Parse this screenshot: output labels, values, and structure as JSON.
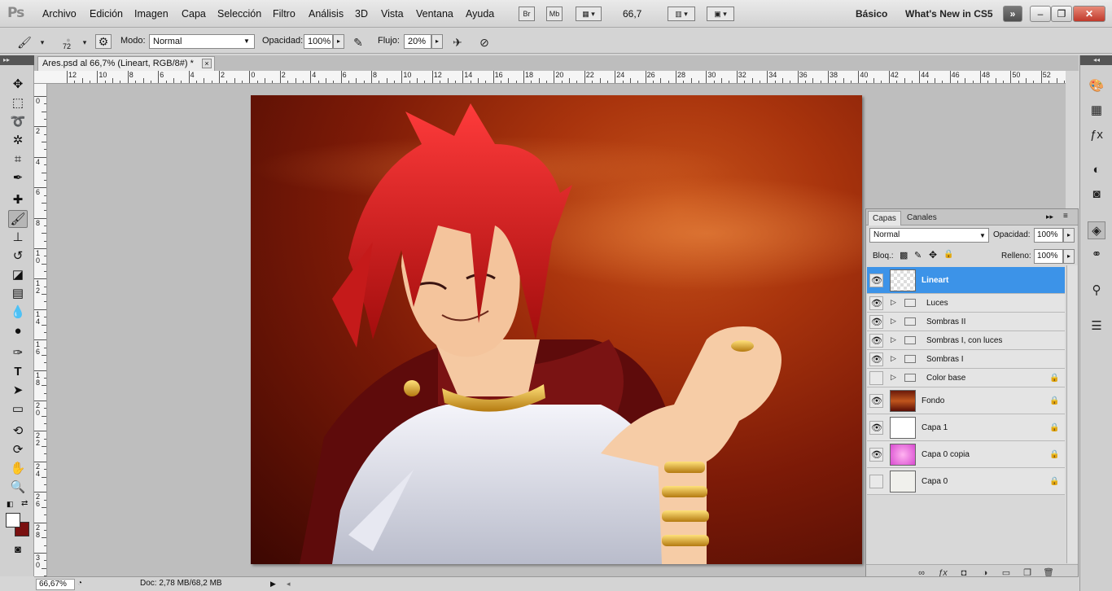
{
  "app": {
    "logo": "Ps",
    "menu": [
      "Archivo",
      "Edición",
      "Imagen",
      "Capa",
      "Selección",
      "Filtro",
      "Análisis",
      "3D",
      "Vista",
      "Ventana",
      "Ayuda"
    ],
    "bridge_label": "Br",
    "minibridge_label": "Mb",
    "zoom_value": "66,7",
    "workspace": "Básico",
    "whats_new": "What's New in CS5"
  },
  "options": {
    "brush_size": "72",
    "mode_label": "Modo:",
    "mode_value": "Normal",
    "opacity_label": "Opacidad:",
    "opacity_value": "100%",
    "flow_label": "Flujo:",
    "flow_value": "20%"
  },
  "document": {
    "tab_title": "Ares.psd al 66,7% (Lineart, RGB/8#) *",
    "close": "×"
  },
  "rulers": {
    "h_labels": [
      "12",
      "10",
      "8",
      "6",
      "4",
      "2",
      "0",
      "2",
      "4",
      "6",
      "8",
      "10",
      "12",
      "14",
      "16",
      "18",
      "20",
      "22",
      "24",
      "26",
      "28",
      "30",
      "32",
      "34",
      "36",
      "38",
      "40",
      "42",
      "44",
      "46",
      "48",
      "50",
      "52"
    ],
    "v_labels": [
      "0",
      "2",
      "4",
      "6",
      "8",
      "1\n0",
      "1\n2",
      "1\n4",
      "1\n6",
      "1\n8",
      "2\n0",
      "2\n2",
      "2\n4",
      "2\n6",
      "2\n8",
      "3\n0"
    ]
  },
  "status": {
    "zoom": "66,67%",
    "doc": "Doc: 2,78 MB/68,2 MB"
  },
  "layers_panel": {
    "tabs": [
      "Capas",
      "Canales"
    ],
    "blend_mode": "Normal",
    "opacity_label": "Opacidad:",
    "opacity_value": "100%",
    "lock_label": "Bloq.:",
    "fill_label": "Relleno:",
    "fill_value": "100%",
    "layers": [
      {
        "name": "Lineart",
        "type": "layer",
        "visible": true,
        "selected": true,
        "locked": false
      },
      {
        "name": "Luces",
        "type": "group",
        "visible": true,
        "selected": false,
        "locked": false
      },
      {
        "name": "Sombras II",
        "type": "group",
        "visible": true,
        "selected": false,
        "locked": false
      },
      {
        "name": "Sombras I, con luces",
        "type": "group",
        "visible": true,
        "selected": false,
        "locked": false
      },
      {
        "name": "Sombras I",
        "type": "group",
        "visible": true,
        "selected": false,
        "locked": false
      },
      {
        "name": "Color base",
        "type": "group",
        "visible": false,
        "selected": false,
        "locked": true
      },
      {
        "name": "Fondo",
        "type": "layer",
        "visible": true,
        "selected": false,
        "locked": true
      },
      {
        "name": "Capa 1",
        "type": "layer",
        "visible": true,
        "selected": false,
        "locked": true
      },
      {
        "name": "Capa 0 copia",
        "type": "layer",
        "visible": true,
        "selected": false,
        "locked": true
      },
      {
        "name": "Capa 0",
        "type": "layer",
        "visible": false,
        "selected": false,
        "locked": true
      }
    ]
  },
  "colors": {
    "foreground": "#ffffff",
    "background": "#7a1010",
    "selection": "#3c93e8"
  }
}
